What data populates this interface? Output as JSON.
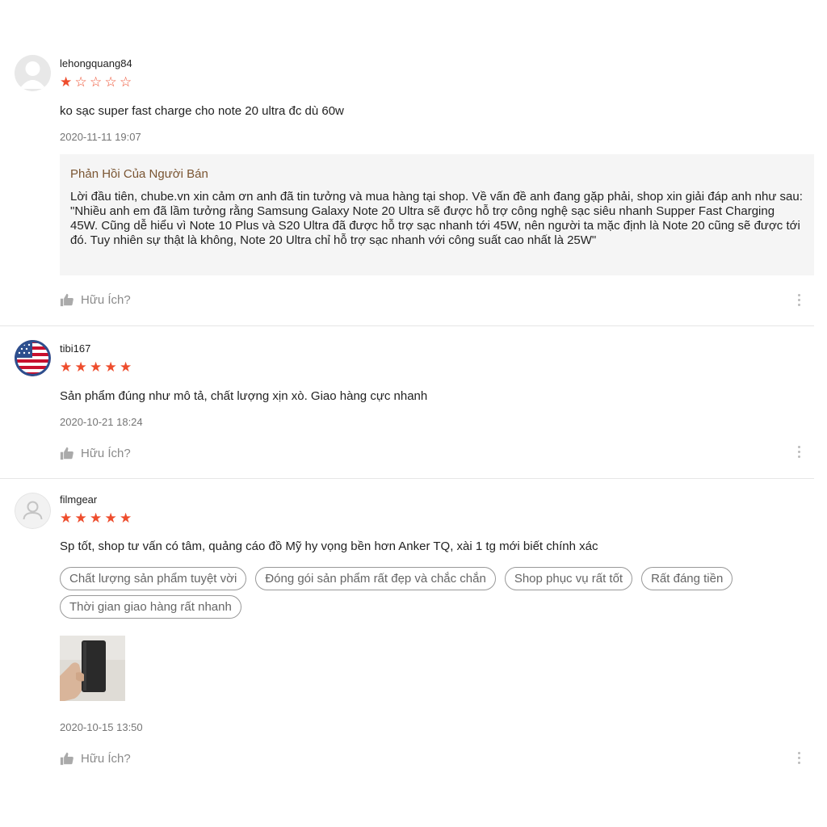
{
  "reviews": [
    {
      "username": "lehongquang84",
      "rating": 1,
      "comment": "ko sạc super fast charge cho note 20 ultra đc dù 60w",
      "date": "2020-11-11 19:07",
      "seller_reply": {
        "title": "Phản Hồi Của Người Bán",
        "text": "Lời đầu tiên, chube.vn xin cảm ơn anh đã tin tưởng và mua hàng tại shop. Về vấn đề anh đang gặp phải, shop xin giải đáp anh như sau:\n\"Nhiều anh em đã lầm tưởng rằng Samsung Galaxy Note 20 Ultra sẽ được hỗ trợ công nghệ sạc siêu nhanh Supper Fast Charging 45W. Cũng dễ hiểu vì Note 10 Plus và S20 Ultra đã được hỗ trợ sạc nhanh tới 45W, nên người ta mặc định là Note 20 cũng sẽ được tới đó. Tuy nhiên sự thật là không, Note 20 Ultra chỉ hỗ trợ sạc nhanh với công suất cao nhất là 25W\""
      },
      "helpful_label": "Hữu Ích?"
    },
    {
      "username": "tibi167",
      "rating": 5,
      "comment": "Sản phẩm đúng như mô tả, chất lượng xịn xò. Giao hàng cực nhanh",
      "date": "2020-10-21 18:24",
      "helpful_label": "Hữu Ích?"
    },
    {
      "username": "filmgear",
      "rating": 5,
      "comment": "Sp tốt, shop tư vấn có tâm, quảng cáo đồ Mỹ hy vọng bền hơn Anker TQ, xài 1 tg mới biết chính xác",
      "tags": [
        "Chất lượng sản phẩm tuyệt vời",
        "Đóng gói sản phẩm rất đẹp và chắc chắn",
        "Shop phục vụ rất tốt",
        "Rất đáng tiền",
        "Thời gian giao hàng rất nhanh"
      ],
      "date": "2020-10-15 13:50",
      "helpful_label": "Hữu Ích?"
    }
  ],
  "colors": {
    "star": "#ee4d2d",
    "seller_reply_title": "#7a5532",
    "muted": "#757575",
    "reply_bg": "#f5f5f5"
  },
  "icons": [
    "default-avatar-icon",
    "flag-avatar",
    "star-icon",
    "thumbs-up-icon",
    "more-vertical-icon",
    "review-photo"
  ]
}
